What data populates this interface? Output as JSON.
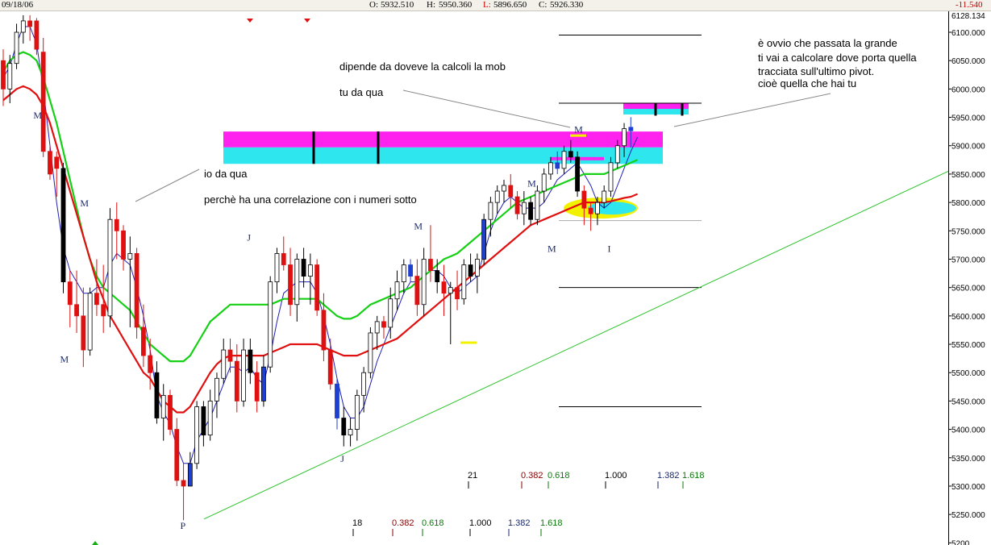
{
  "header": {
    "date": "09/18/06",
    "open_label": "O:",
    "open": "5932.510",
    "high_label": "H:",
    "high": "5950.360",
    "low_label": "L:",
    "low": "5896.650",
    "close_label": "C:",
    "close": "5926.330",
    "change": "-11.540"
  },
  "chart_data": {
    "type": "candlestick",
    "ylim": [
      5195,
      6135
    ],
    "y_ticks": [
      "6100.000",
      "6050.000",
      "6000.000",
      "5950.000",
      "5900.000",
      "5850.000",
      "5800.000",
      "5750.000",
      "5700.000",
      "5650.000",
      "5600.000",
      "5550.000",
      "5500.000",
      "5450.000",
      "5400.000",
      "5350.000",
      "5300.000",
      "5250.000",
      "5200"
    ],
    "y_tick_values": [
      6100,
      6050,
      6000,
      5950,
      5900,
      5850,
      5800,
      5750,
      5700,
      5650,
      5600,
      5550,
      5500,
      5450,
      5400,
      5350,
      5300,
      5250,
      5200
    ],
    "top_tick_label": "6128.134",
    "candles": [
      [
        6050,
        6070,
        5970,
        6000
      ],
      [
        6000,
        6060,
        5975,
        6045
      ],
      [
        6045,
        6115,
        6035,
        6100
      ],
      [
        6100,
        6130,
        6080,
        6120
      ],
      [
        6120,
        6130,
        6085,
        6110
      ],
      [
        6120,
        6125,
        6060,
        6070
      ],
      [
        6065,
        6090,
        5880,
        5890
      ],
      [
        5890,
        5900,
        5840,
        5850
      ],
      [
        5880,
        5890,
        5810,
        5860
      ],
      [
        5860,
        5870,
        5640,
        5660
      ],
      [
        5660,
        5680,
        5580,
        5620
      ],
      [
        5620,
        5680,
        5570,
        5600
      ],
      [
        5600,
        5650,
        5510,
        5540
      ],
      [
        5540,
        5650,
        5530,
        5640
      ],
      [
        5640,
        5700,
        5600,
        5620
      ],
      [
        5620,
        5690,
        5570,
        5600
      ],
      [
        5600,
        5790,
        5580,
        5770
      ],
      [
        5770,
        5800,
        5700,
        5750
      ],
      [
        5750,
        5760,
        5680,
        5700
      ],
      [
        5700,
        5740,
        5580,
        5710
      ],
      [
        5710,
        5720,
        5560,
        5580
      ],
      [
        5580,
        5620,
        5510,
        5530
      ],
      [
        5530,
        5560,
        5470,
        5500
      ],
      [
        5500,
        5520,
        5410,
        5420
      ],
      [
        5420,
        5480,
        5380,
        5460
      ],
      [
        5460,
        5470,
        5390,
        5400
      ],
      [
        5400,
        5420,
        5300,
        5310
      ],
      [
        5310,
        5340,
        5240,
        5300
      ],
      [
        5300,
        5360,
        5320,
        5340
      ],
      [
        5340,
        5450,
        5330,
        5440
      ],
      [
        5440,
        5450,
        5370,
        5390
      ],
      [
        5390,
        5470,
        5380,
        5450
      ],
      [
        5450,
        5500,
        5420,
        5490
      ],
      [
        5490,
        5560,
        5480,
        5540
      ],
      [
        5540,
        5560,
        5500,
        5520
      ],
      [
        5520,
        5550,
        5430,
        5450
      ],
      [
        5450,
        5560,
        5440,
        5540
      ],
      [
        5540,
        5560,
        5480,
        5500
      ],
      [
        5500,
        5520,
        5430,
        5450
      ],
      [
        5450,
        5530,
        5440,
        5510
      ],
      [
        5510,
        5670,
        5500,
        5660
      ],
      [
        5660,
        5720,
        5640,
        5710
      ],
      [
        5710,
        5740,
        5680,
        5690
      ],
      [
        5690,
        5720,
        5600,
        5620
      ],
      [
        5620,
        5710,
        5590,
        5700
      ],
      [
        5700,
        5720,
        5650,
        5670
      ],
      [
        5670,
        5710,
        5620,
        5690
      ],
      [
        5690,
        5700,
        5600,
        5610
      ],
      [
        5610,
        5640,
        5520,
        5540
      ],
      [
        5540,
        5560,
        5470,
        5480
      ],
      [
        5480,
        5490,
        5400,
        5420
      ],
      [
        5420,
        5440,
        5370,
        5390
      ],
      [
        5390,
        5420,
        5370,
        5400
      ],
      [
        5400,
        5470,
        5380,
        5460
      ],
      [
        5460,
        5510,
        5430,
        5500
      ],
      [
        5500,
        5580,
        5490,
        5570
      ],
      [
        5570,
        5600,
        5540,
        5590
      ],
      [
        5590,
        5600,
        5560,
        5580
      ],
      [
        5580,
        5650,
        5560,
        5630
      ],
      [
        5630,
        5680,
        5610,
        5660
      ],
      [
        5660,
        5700,
        5640,
        5690
      ],
      [
        5690,
        5700,
        5660,
        5670
      ],
      [
        5670,
        5700,
        5600,
        5620
      ],
      [
        5620,
        5720,
        5600,
        5700
      ],
      [
        5700,
        5760,
        5660,
        5680
      ],
      [
        5680,
        5700,
        5640,
        5660
      ],
      [
        5660,
        5690,
        5600,
        5640
      ],
      [
        5640,
        5660,
        5550,
        5650
      ],
      [
        5650,
        5680,
        5610,
        5630
      ],
      [
        5630,
        5700,
        5620,
        5690
      ],
      [
        5690,
        5710,
        5660,
        5670
      ],
      [
        5670,
        5710,
        5640,
        5700
      ],
      [
        5700,
        5780,
        5690,
        5770
      ],
      [
        5770,
        5810,
        5740,
        5800
      ],
      [
        5800,
        5830,
        5780,
        5820
      ],
      [
        5820,
        5840,
        5800,
        5830
      ],
      [
        5830,
        5850,
        5790,
        5810
      ],
      [
        5810,
        5820,
        5770,
        5780
      ],
      [
        5780,
        5820,
        5760,
        5800
      ],
      [
        5800,
        5810,
        5760,
        5770
      ],
      [
        5770,
        5830,
        5760,
        5820
      ],
      [
        5820,
        5860,
        5800,
        5850
      ],
      [
        5850,
        5880,
        5840,
        5870
      ],
      [
        5870,
        5890,
        5850,
        5860
      ],
      [
        5860,
        5900,
        5850,
        5890
      ],
      [
        5890,
        5910,
        5870,
        5880
      ],
      [
        5880,
        5890,
        5810,
        5820
      ],
      [
        5820,
        5830,
        5760,
        5790
      ],
      [
        5790,
        5800,
        5750,
        5780
      ],
      [
        5780,
        5810,
        5760,
        5800
      ],
      [
        5800,
        5830,
        5790,
        5820
      ],
      [
        5820,
        5880,
        5810,
        5870
      ],
      [
        5870,
        5910,
        5860,
        5900
      ],
      [
        5900,
        5940,
        5880,
        5930
      ],
      [
        5932.51,
        5950.36,
        5896.65,
        5926.33
      ]
    ],
    "series": [
      {
        "name": "",
        "color": "#1f1fb4",
        "values": [
          6020,
          6040,
          6080,
          6110,
          6110,
          6080,
          6000,
          5900,
          5800,
          5720,
          5680,
          5660,
          5640,
          5640,
          5650,
          5650,
          5690,
          5710,
          5700,
          5690,
          5650,
          5600,
          5540,
          5460,
          5430,
          5410,
          5370,
          5340,
          5340,
          5380,
          5400,
          5420,
          5450,
          5480,
          5510,
          5510,
          5500,
          5510,
          5490,
          5480,
          5530,
          5590,
          5640,
          5650,
          5660,
          5660,
          5660,
          5640,
          5600,
          5550,
          5490,
          5440,
          5420,
          5420,
          5440,
          5480,
          5520,
          5550,
          5580,
          5610,
          5640,
          5660,
          5660,
          5670,
          5680,
          5680,
          5670,
          5650,
          5640,
          5650,
          5660,
          5670,
          5710,
          5750,
          5780,
          5800,
          5810,
          5800,
          5790,
          5790,
          5790,
          5800,
          5820,
          5840,
          5850,
          5860,
          5870,
          5850,
          5830,
          5800,
          5790,
          5800,
          5830,
          5860,
          5890,
          5915
        ]
      },
      {
        "name": "",
        "color": "#16d016",
        "values": [
          6030,
          6050,
          6060,
          6065,
          6060,
          6050,
          6020,
          5980,
          5940,
          5890,
          5840,
          5790,
          5740,
          5700,
          5670,
          5650,
          5640,
          5630,
          5620,
          5610,
          5590,
          5570,
          5550,
          5540,
          5530,
          5520,
          5520,
          5520,
          5530,
          5550,
          5570,
          5590,
          5600,
          5610,
          5620,
          5620,
          5620,
          5620,
          5620,
          5620,
          5620,
          5625,
          5630,
          5630,
          5630,
          5630,
          5630,
          5630,
          5620,
          5610,
          5600,
          5595,
          5595,
          5600,
          5610,
          5620,
          5625,
          5630,
          5635,
          5640,
          5645,
          5650,
          5660,
          5670,
          5680,
          5690,
          5700,
          5705,
          5710,
          5720,
          5730,
          5740,
          5750,
          5760,
          5770,
          5780,
          5790,
          5800,
          5805,
          5810,
          5815,
          5820,
          5825,
          5830,
          5835,
          5840,
          5845,
          5850,
          5850,
          5850,
          5850,
          5855,
          5860,
          5865,
          5870,
          5875
        ]
      },
      {
        "name": "",
        "color": "#e01010",
        "values": [
          5980,
          5990,
          6000,
          6005,
          6000,
          5990,
          5970,
          5940,
          5900,
          5860,
          5820,
          5780,
          5740,
          5700,
          5660,
          5630,
          5600,
          5580,
          5560,
          5540,
          5520,
          5500,
          5490,
          5470,
          5450,
          5440,
          5430,
          5430,
          5440,
          5460,
          5480,
          5500,
          5515,
          5525,
          5530,
          5530,
          5530,
          5530,
          5530,
          5530,
          5535,
          5540,
          5545,
          5550,
          5550,
          5550,
          5550,
          5550,
          5545,
          5540,
          5535,
          5530,
          5530,
          5530,
          5535,
          5540,
          5545,
          5550,
          5555,
          5560,
          5570,
          5580,
          5590,
          5600,
          5610,
          5620,
          5630,
          5640,
          5650,
          5660,
          5670,
          5680,
          5690,
          5700,
          5710,
          5720,
          5730,
          5740,
          5750,
          5760,
          5765,
          5770,
          5775,
          5780,
          5785,
          5790,
          5795,
          5800,
          5800,
          5800,
          5800,
          5802,
          5805,
          5808,
          5810,
          5815
        ]
      }
    ],
    "labels": [
      {
        "text": "M",
        "x": 5,
        "price": 5955
      },
      {
        "text": "M",
        "x": 12,
        "price": 5800
      },
      {
        "text": "M",
        "x": 9,
        "price": 5525
      },
      {
        "text": "P",
        "x": 27,
        "price": 5232
      },
      {
        "text": "J",
        "x": 37,
        "price": 5740
      },
      {
        "text": "J",
        "x": 51,
        "price": 5350
      },
      {
        "text": "M",
        "x": 62,
        "price": 5760
      },
      {
        "text": "M",
        "x": 79,
        "price": 5835
      },
      {
        "text": "M",
        "x": 82,
        "price": 5720
      },
      {
        "text": "M",
        "x": 86,
        "price": 5930
      },
      {
        "text": "I",
        "x": 91,
        "price": 5720
      }
    ],
    "fib_levels_upper": [
      {
        "label": "21",
        "color": "#000000"
      },
      {
        "label": "0.382",
        "color": "#8b0000"
      },
      {
        "label": "0.618",
        "color": "#0a7a0a"
      },
      {
        "label": "1.000",
        "color": "#000000"
      },
      {
        "label": "1.382",
        "color": "#1a2a6c"
      },
      {
        "label": "1.618",
        "color": "#0a7a0a"
      }
    ],
    "fib_levels_lower": [
      {
        "label": "18",
        "color": "#000000"
      },
      {
        "label": "0.382",
        "color": "#8b0000"
      },
      {
        "label": "0.618",
        "color": "#0a7a0a"
      },
      {
        "label": "1.000",
        "color": "#000000"
      },
      {
        "label": "1.382",
        "color": "#1a2a6c"
      },
      {
        "label": "1.618",
        "color": "#0a7a0a"
      }
    ],
    "horizontal_levels": [
      6095,
      5975,
      5768,
      5650,
      5440
    ],
    "colors": {
      "up": "#ffffff",
      "down": "#e01010",
      "black_down": "#000000",
      "blue": "#1f3fd0",
      "magenta": "#ff22ee",
      "cyan": "#2ee6ee",
      "yellow": "#f2f200",
      "trend": "#2ec42e"
    }
  },
  "annotations": {
    "note_top": "dipende da doveve la calcoli la mob",
    "note_tu": "tu da qua",
    "note_io": "io da qua",
    "note_perche": "perchè ha una correlazione con i numeri sotto",
    "note_right_1": "è ovvio che passata la grande",
    "note_right_2": "ti vai a calcolare dove porta quella",
    "note_right_3": "tracciata sull'ultimo pivot.",
    "note_right_4": "cioè quella che hai tu"
  }
}
